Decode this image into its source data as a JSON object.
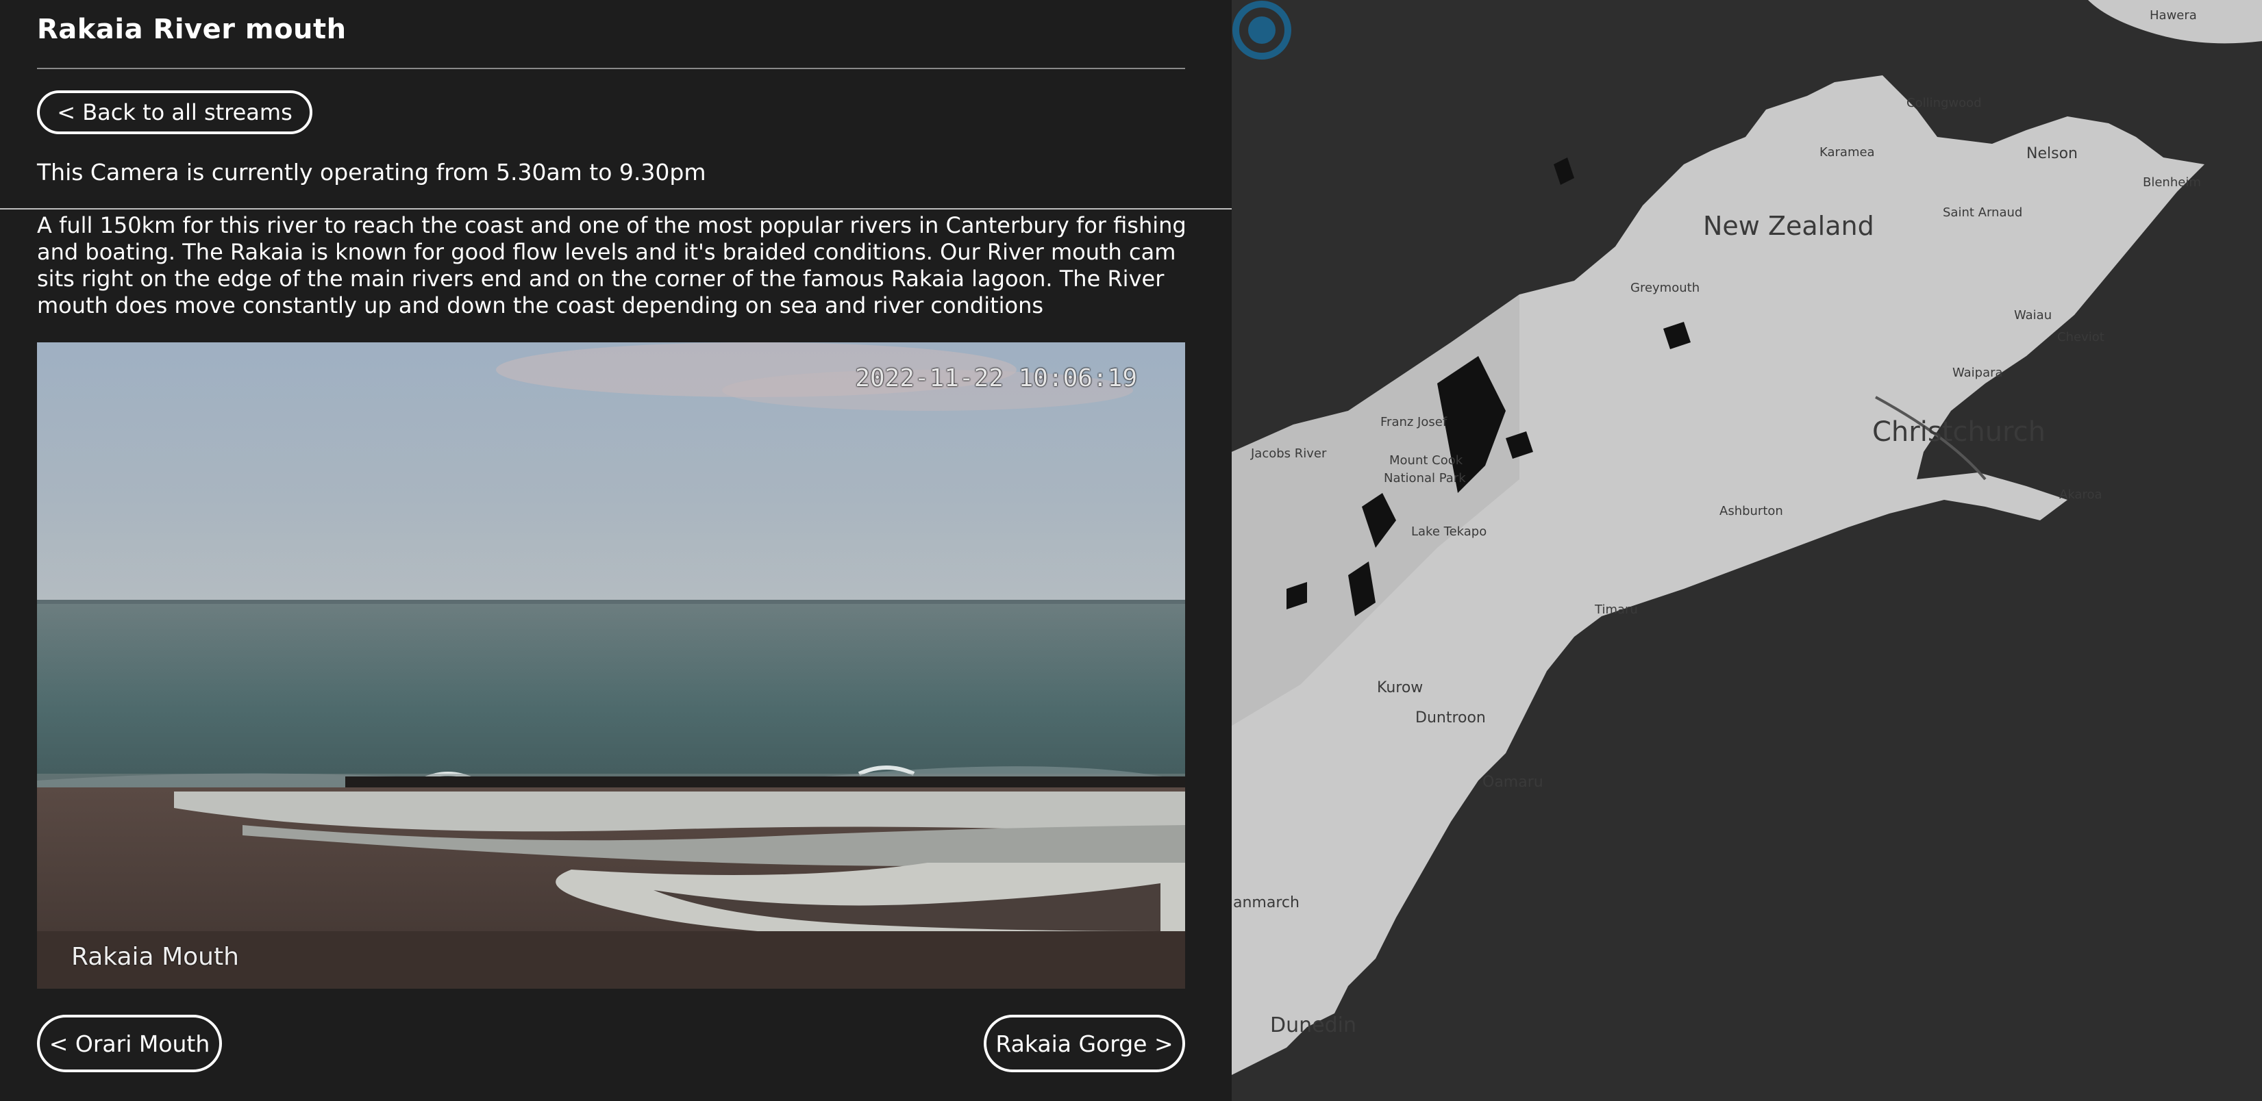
{
  "header": {
    "title": "Rakaia River mouth"
  },
  "nav": {
    "back_label": "< Back to all streams",
    "prev_label": "< Orari Mouth",
    "next_label": "Rakaia Gorge >"
  },
  "camera": {
    "hours": "This Camera is currently operating from 5.30am to 9.30pm",
    "description": "A full 150km for this river to reach the coast and one of the most popular rivers in Canterbury for fishing and boating. The Rakaia is known for good flow levels and it's braided conditions. Our River mouth cam sits right on the edge of the main rivers end and on the corner of the famous Rakaia lagoon. The River mouth does move constantly up and down the coast depending on sea and river conditions",
    "timestamp": "2022-11-22 10:06:19",
    "overlay_label": "Rakaia Mouth"
  },
  "map": {
    "labels": {
      "country": "New Zealand",
      "christchurch": "Christchurch",
      "collingwood": "Collingwood",
      "nelson": "Nelson",
      "karamea": "Karamea",
      "blenheim": "Blenheim",
      "saint_arnaud": "Saint Arnaud",
      "greymouth": "Greymouth",
      "waiau": "Waiau",
      "cheviot": "Cheviot",
      "waipara": "Waipara",
      "franz_josef": "Franz Josef",
      "jacobs_river": "Jacobs River",
      "mount_cook": "Mount Cook",
      "national_park": "National Park",
      "ashburton": "Ashburton",
      "akaroa": "Akaroa",
      "lake_tekapo": "Lake Tekapo",
      "timaru": "Timaru",
      "kurow": "Kurow",
      "duntroon": "Duntroon",
      "oamaru": "Oamaru",
      "ranmarch": "anmarch",
      "dunedin": "Dunedin",
      "hawera": "Hawera"
    },
    "marker_icon": "location-target-icon",
    "marker_color": "#1c5f86"
  }
}
